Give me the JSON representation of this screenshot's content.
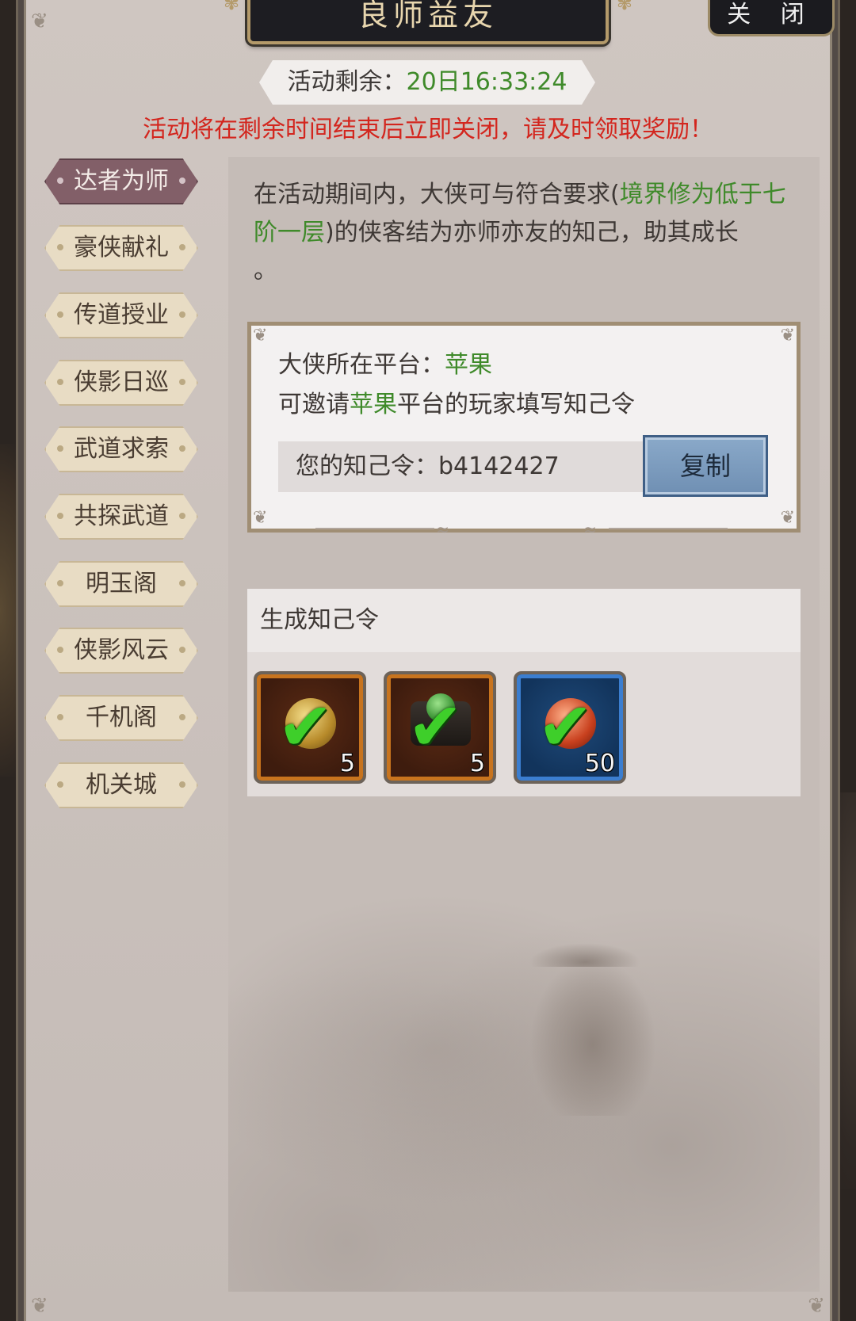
{
  "window": {
    "title": "良师益友",
    "close_label": "关 闭"
  },
  "timer": {
    "label": "活动剩余：",
    "value": "20日16:33:24"
  },
  "warning": "活动将在剩余时间结束后立即关闭，请及时领取奖励！",
  "sidebar": {
    "items": [
      {
        "label": "达者为师",
        "active": true
      },
      {
        "label": "豪侠献礼",
        "active": false
      },
      {
        "label": "传道授业",
        "active": false
      },
      {
        "label": "侠影日巡",
        "active": false
      },
      {
        "label": "武道求索",
        "active": false
      },
      {
        "label": "共探武道",
        "active": false
      },
      {
        "label": "明玉阁",
        "active": false
      },
      {
        "label": "侠影风云",
        "active": false
      },
      {
        "label": "千机阁",
        "active": false
      },
      {
        "label": "机关城",
        "active": false
      }
    ]
  },
  "description": {
    "part1": "在活动期间内，大侠可与符合要求(",
    "highlight": "境界修为低于七阶一层",
    "part2": ")的侠客结为亦师亦友的知己，助其成长",
    "part3": "。"
  },
  "code_box": {
    "platform_label": "大侠所在平台：",
    "platform_value": "苹果",
    "invite_prefix": "可邀请",
    "invite_platform": "苹果",
    "invite_suffix": "平台的玩家填写知己令",
    "code_label": "您的知己令：",
    "code_value": "b4142427",
    "copy_label": "复制"
  },
  "generate": {
    "header": "生成知己令",
    "rewards": [
      {
        "icon": "gold-orb-icon",
        "quantity": "5",
        "claimed": true,
        "frame_color": "#c8741e"
      },
      {
        "icon": "jade-box-icon",
        "quantity": "5",
        "claimed": true,
        "frame_color": "#c8741e"
      },
      {
        "icon": "red-orb-icon",
        "quantity": "50",
        "claimed": true,
        "frame_color": "#3b7ed0"
      }
    ]
  },
  "colors": {
    "accent_green": "#3f8a2a",
    "warning_red": "#d3261e",
    "active_tab": "#825f68",
    "copy_button": "#7a9bc0"
  }
}
